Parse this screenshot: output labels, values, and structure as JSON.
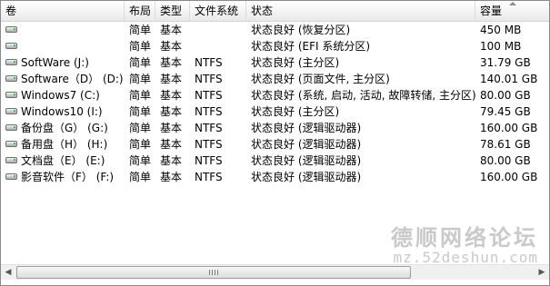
{
  "columns": {
    "volume": "卷",
    "layout": "布局",
    "type": "类型",
    "filesystem": "文件系统",
    "status": "状态",
    "capacity": "容量"
  },
  "rows": [
    {
      "volume": "",
      "layout": "简单",
      "type": "基本",
      "fs": "",
      "status": "状态良好 (恢复分区)",
      "capacity": "450 MB"
    },
    {
      "volume": "",
      "layout": "简单",
      "type": "基本",
      "fs": "",
      "status": "状态良好 (EFI 系统分区)",
      "capacity": "100 MB"
    },
    {
      "volume": "SoftWare (J:)",
      "layout": "简单",
      "type": "基本",
      "fs": "NTFS",
      "status": "状态良好 (主分区)",
      "capacity": "31.79 GB"
    },
    {
      "volume": "Software（D） (D:)",
      "layout": "简单",
      "type": "基本",
      "fs": "NTFS",
      "status": "状态良好 (页面文件, 主分区)",
      "capacity": "140.01 GB"
    },
    {
      "volume": "Windows7 (C:)",
      "layout": "简单",
      "type": "基本",
      "fs": "NTFS",
      "status": "状态良好 (系统, 启动, 活动, 故障转储, 主分区)",
      "capacity": "80.00 GB"
    },
    {
      "volume": "Windows10 (I:)",
      "layout": "简单",
      "type": "基本",
      "fs": "NTFS",
      "status": "状态良好 (主分区)",
      "capacity": "79.45 GB"
    },
    {
      "volume": "备份盘（G） (G:)",
      "layout": "简单",
      "type": "基本",
      "fs": "NTFS",
      "status": "状态良好 (逻辑驱动器)",
      "capacity": "160.00 GB"
    },
    {
      "volume": "备用盘（H） (H:)",
      "layout": "简单",
      "type": "基本",
      "fs": "NTFS",
      "status": "状态良好 (逻辑驱动器)",
      "capacity": "78.61 GB"
    },
    {
      "volume": "文档盘（E） (E:)",
      "layout": "简单",
      "type": "基本",
      "fs": "NTFS",
      "status": "状态良好 (逻辑驱动器)",
      "capacity": "80.00 GB"
    },
    {
      "volume": "影音软件（F） (F:)",
      "layout": "简单",
      "type": "基本",
      "fs": "NTFS",
      "status": "状态良好 (逻辑驱动器)",
      "capacity": "160.00 GB"
    }
  ],
  "watermark": {
    "title": "德顺网络论坛",
    "url": "mz.52deshun.com"
  },
  "scrollbar": {
    "left_arrow": "◀",
    "right_arrow": "▶"
  },
  "icons": {
    "drive": "drive-icon",
    "sort": "sort-arrow-icon"
  }
}
